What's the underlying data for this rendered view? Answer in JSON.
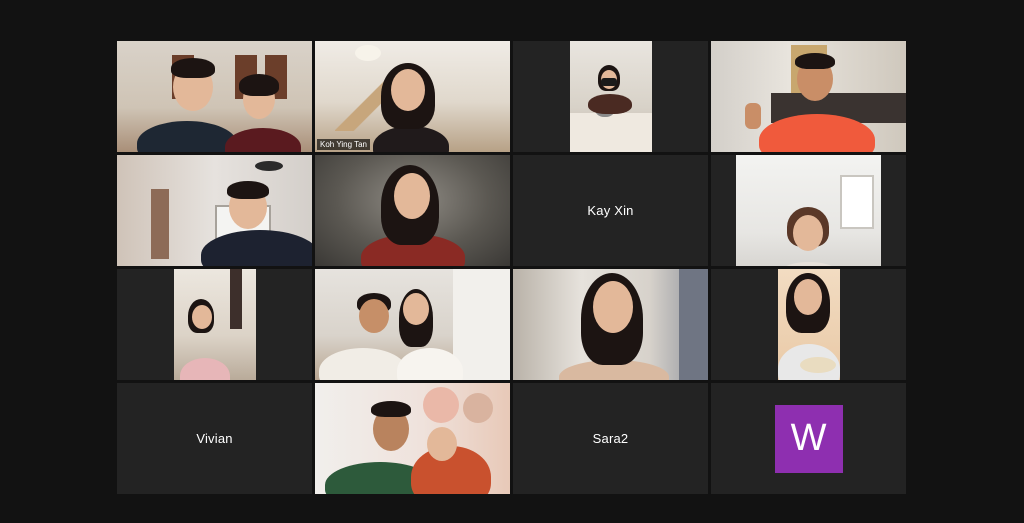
{
  "meeting": {
    "participants": [
      {
        "label": "",
        "type": "video",
        "scene": "couple-living-room"
      },
      {
        "label": "Koh Ying Tan",
        "type": "video",
        "scene": "woman-stairs",
        "active_speaker": true
      },
      {
        "label": "",
        "type": "video",
        "scene": "woman-kitchen-masked"
      },
      {
        "label": "",
        "type": "video",
        "scene": "man-waving-orange"
      },
      {
        "label": "",
        "type": "video",
        "scene": "man-room-fan"
      },
      {
        "label": "",
        "type": "video",
        "scene": "woman-blurred"
      },
      {
        "label": "Kay Xin",
        "type": "name"
      },
      {
        "label": "",
        "type": "video",
        "scene": "woman-glasses-white-room"
      },
      {
        "label": "",
        "type": "video",
        "scene": "woman-peace-sign"
      },
      {
        "label": "",
        "type": "video",
        "scene": "two-women-kitchen"
      },
      {
        "label": "",
        "type": "video",
        "scene": "woman-smiling-close"
      },
      {
        "label": "",
        "type": "video",
        "scene": "woman-bowl"
      },
      {
        "label": "Vivian",
        "type": "name"
      },
      {
        "label": "",
        "type": "video",
        "scene": "couple-hijab"
      },
      {
        "label": "Sara2",
        "type": "name"
      },
      {
        "label": "",
        "type": "avatar",
        "initial": "W"
      }
    ]
  },
  "colors": {
    "background": "#121212",
    "tile": "#232323",
    "active_border": "#c8d86a",
    "avatar": "#8e2fb0"
  }
}
